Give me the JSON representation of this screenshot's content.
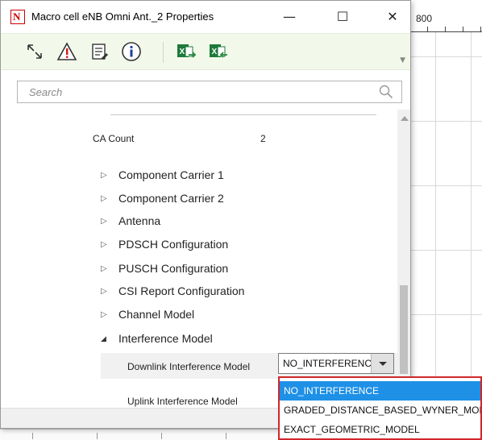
{
  "window": {
    "title": "Macro cell eNB Omni Ant._2 Properties",
    "minimize_glyph": "—",
    "maximize_glyph": "☐",
    "close_glyph": "✕"
  },
  "toolbar": {
    "icons": [
      "expand-icon",
      "warning-icon",
      "notes-icon",
      "info-icon",
      "export-excel-icon",
      "import-excel-icon"
    ]
  },
  "search": {
    "placeholder": "Search"
  },
  "properties": {
    "ca_count_label": "CA Count",
    "ca_count_value": "2",
    "tree": [
      {
        "label": "Component Carrier 1",
        "expanded": false
      },
      {
        "label": "Component Carrier 2",
        "expanded": false
      },
      {
        "label": "Antenna",
        "expanded": false
      },
      {
        "label": "PDSCH Configuration",
        "expanded": false
      },
      {
        "label": "PUSCH Configuration",
        "expanded": false
      },
      {
        "label": "CSI Report Configuration",
        "expanded": false
      },
      {
        "label": "Channel Model",
        "expanded": false
      },
      {
        "label": "Interference Model",
        "expanded": true
      }
    ],
    "downlink_label": "Downlink Interference Model",
    "uplink_label": "Uplink Interference Model"
  },
  "dropdown": {
    "selected": "NO_INTERFERENCE",
    "options": [
      "NO_INTERFERENCE",
      "GRADED_DISTANCE_BASED_WYNER_MODEL",
      "EXACT_GEOMETRIC_MODEL"
    ]
  },
  "background": {
    "ruler_label": "800"
  },
  "colors": {
    "toolbar_bg": "#f3f9ea",
    "selected_option": "#1e90e6",
    "dropdown_border": "#d0262b"
  }
}
